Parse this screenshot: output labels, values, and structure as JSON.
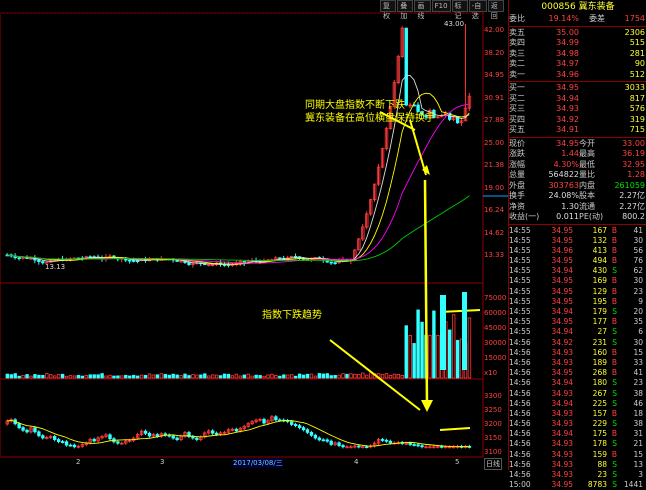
{
  "toolbar": [
    "复权",
    "叠加",
    "画线",
    "F10",
    "标记",
    "-自选",
    "返回"
  ],
  "stock": {
    "code": "000856",
    "name": "冀东装备"
  },
  "order_book": {
    "ratio_label": "委比",
    "ratio": "19.14%",
    "diff_label": "委差",
    "diff": "1754",
    "asks": [
      {
        "label": "卖五",
        "price": "35.00",
        "vol": "2306"
      },
      {
        "label": "卖四",
        "price": "34.99",
        "vol": "515"
      },
      {
        "label": "卖三",
        "price": "34.98",
        "vol": "281"
      },
      {
        "label": "卖二",
        "price": "34.97",
        "vol": "90"
      },
      {
        "label": "卖一",
        "price": "34.96",
        "vol": "512"
      }
    ],
    "bids": [
      {
        "label": "买一",
        "price": "34.95",
        "vol": "3033"
      },
      {
        "label": "买二",
        "price": "34.94",
        "vol": "817"
      },
      {
        "label": "买三",
        "price": "34.93",
        "vol": "576"
      },
      {
        "label": "买四",
        "price": "34.92",
        "vol": "319"
      },
      {
        "label": "买五",
        "price": "34.91",
        "vol": "715"
      }
    ]
  },
  "quote": [
    {
      "l1": "现价",
      "v1": "34.95",
      "l2": "今开",
      "v2": "33.00"
    },
    {
      "l1": "涨跌",
      "v1": "1.44",
      "l2": "最高",
      "v2": "36.19"
    },
    {
      "l1": "涨幅",
      "v1": "4.30%",
      "l2": "最低",
      "v2": "32.95"
    },
    {
      "l1": "总量",
      "v1": "564822",
      "l2": "量比",
      "v2": "1.28"
    },
    {
      "l1": "外盘",
      "v1": "303763",
      "l2": "内盘",
      "v2": "261059"
    },
    {
      "l1": "换手",
      "v1": "24.08%",
      "l2": "股本",
      "v2": "2.27亿"
    },
    {
      "l1": "净资",
      "v1": "1.30",
      "l2": "流通",
      "v2": "2.27亿"
    },
    {
      "l1": "收益(一)",
      "v1": "0.011",
      "l2": "PE(动)",
      "v2": "800.2"
    }
  ],
  "ticks": [
    [
      "14:55",
      "34.95",
      "167",
      "B",
      "41"
    ],
    [
      "14:55",
      "34.95",
      "132",
      "B",
      "30"
    ],
    [
      "14:55",
      "34.96",
      "413",
      "B",
      "56"
    ],
    [
      "14:55",
      "34.95",
      "494",
      "B",
      "76"
    ],
    [
      "14:55",
      "34.94",
      "430",
      "S",
      "62"
    ],
    [
      "14:55",
      "34.95",
      "169",
      "B",
      "30"
    ],
    [
      "14:55",
      "34.95",
      "129",
      "B",
      "23"
    ],
    [
      "14:55",
      "34.95",
      "195",
      "B",
      "9"
    ],
    [
      "14:55",
      "34.94",
      "179",
      "S",
      "20"
    ],
    [
      "14:55",
      "34.95",
      "177",
      "B",
      "35"
    ],
    [
      "14:55",
      "34.94",
      "27",
      "S",
      "6"
    ],
    [
      "14:56",
      "34.92",
      "231",
      "S",
      "30"
    ],
    [
      "14:56",
      "34.93",
      "160",
      "B",
      "15"
    ],
    [
      "14:56",
      "34.93",
      "189",
      "B",
      "33"
    ],
    [
      "14:56",
      "34.95",
      "268",
      "B",
      "41"
    ],
    [
      "14:56",
      "34.94",
      "180",
      "S",
      "23"
    ],
    [
      "14:56",
      "34.93",
      "267",
      "S",
      "38"
    ],
    [
      "14:56",
      "34.94",
      "225",
      "S",
      "46"
    ],
    [
      "14:56",
      "34.93",
      "157",
      "B",
      "18"
    ],
    [
      "14:56",
      "34.93",
      "229",
      "S",
      "38"
    ],
    [
      "14:56",
      "34.94",
      "175",
      "B",
      "31"
    ],
    [
      "14:56",
      "34.93",
      "178",
      "S",
      "21"
    ],
    [
      "14:56",
      "34.93",
      "159",
      "B",
      "15"
    ],
    [
      "14:56",
      "34.93",
      "88",
      "S",
      "13"
    ],
    [
      "14:56",
      "34.93",
      "23",
      "S",
      "3"
    ],
    [
      "15:00",
      "34.95",
      "8783",
      "S",
      "1441"
    ]
  ],
  "price_axis": [
    "42.00",
    "38.20",
    "34.95",
    "30.91",
    "27.88",
    "25.00",
    "21.38",
    "19.00",
    "16.24",
    "14.62",
    "13.33"
  ],
  "vol_axis": [
    "75000",
    "60000",
    "45000",
    "30000",
    "15000",
    "x10"
  ],
  "index_axis": [
    "3300",
    "3250",
    "3200",
    "3150",
    "3100"
  ],
  "annotations": {
    "main_line1": "同期大盘指数不断下跌",
    "main_line2": "冀东装备在高位横盘保持换手",
    "index_note": "指数下跌趋势",
    "high_label": "43.00",
    "low_label": "13.13"
  },
  "dates": [
    "2",
    "3",
    "2017/03/08/三",
    "4",
    "5"
  ],
  "corner_label": "日线",
  "colors": {
    "up": "#ff3b3b",
    "down": "#3ff",
    "accent": "#ff0",
    "grid": "#8b0000"
  },
  "chart_data": {
    "type": "candlestick",
    "title": "000856 冀东装备 日线",
    "price_range": [
      13.13,
      43.0
    ],
    "high": 43.0,
    "low": 13.13,
    "last": 34.95,
    "volume_range": [
      0,
      75000
    ],
    "index_range": [
      3100,
      3300
    ]
  }
}
